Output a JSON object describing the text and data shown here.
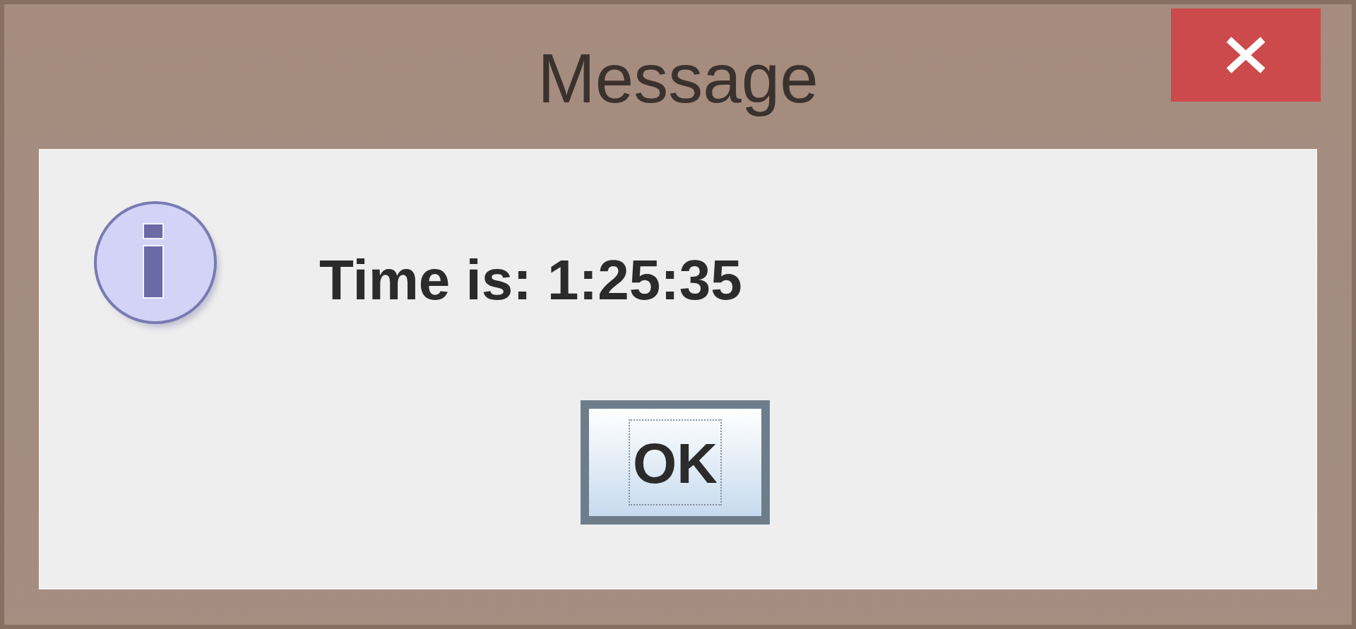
{
  "window": {
    "title": "Message"
  },
  "message": {
    "kind": "information",
    "text": "Time is: 1:25:35"
  },
  "buttons": [
    {
      "label": "OK",
      "focused": true
    }
  ]
}
